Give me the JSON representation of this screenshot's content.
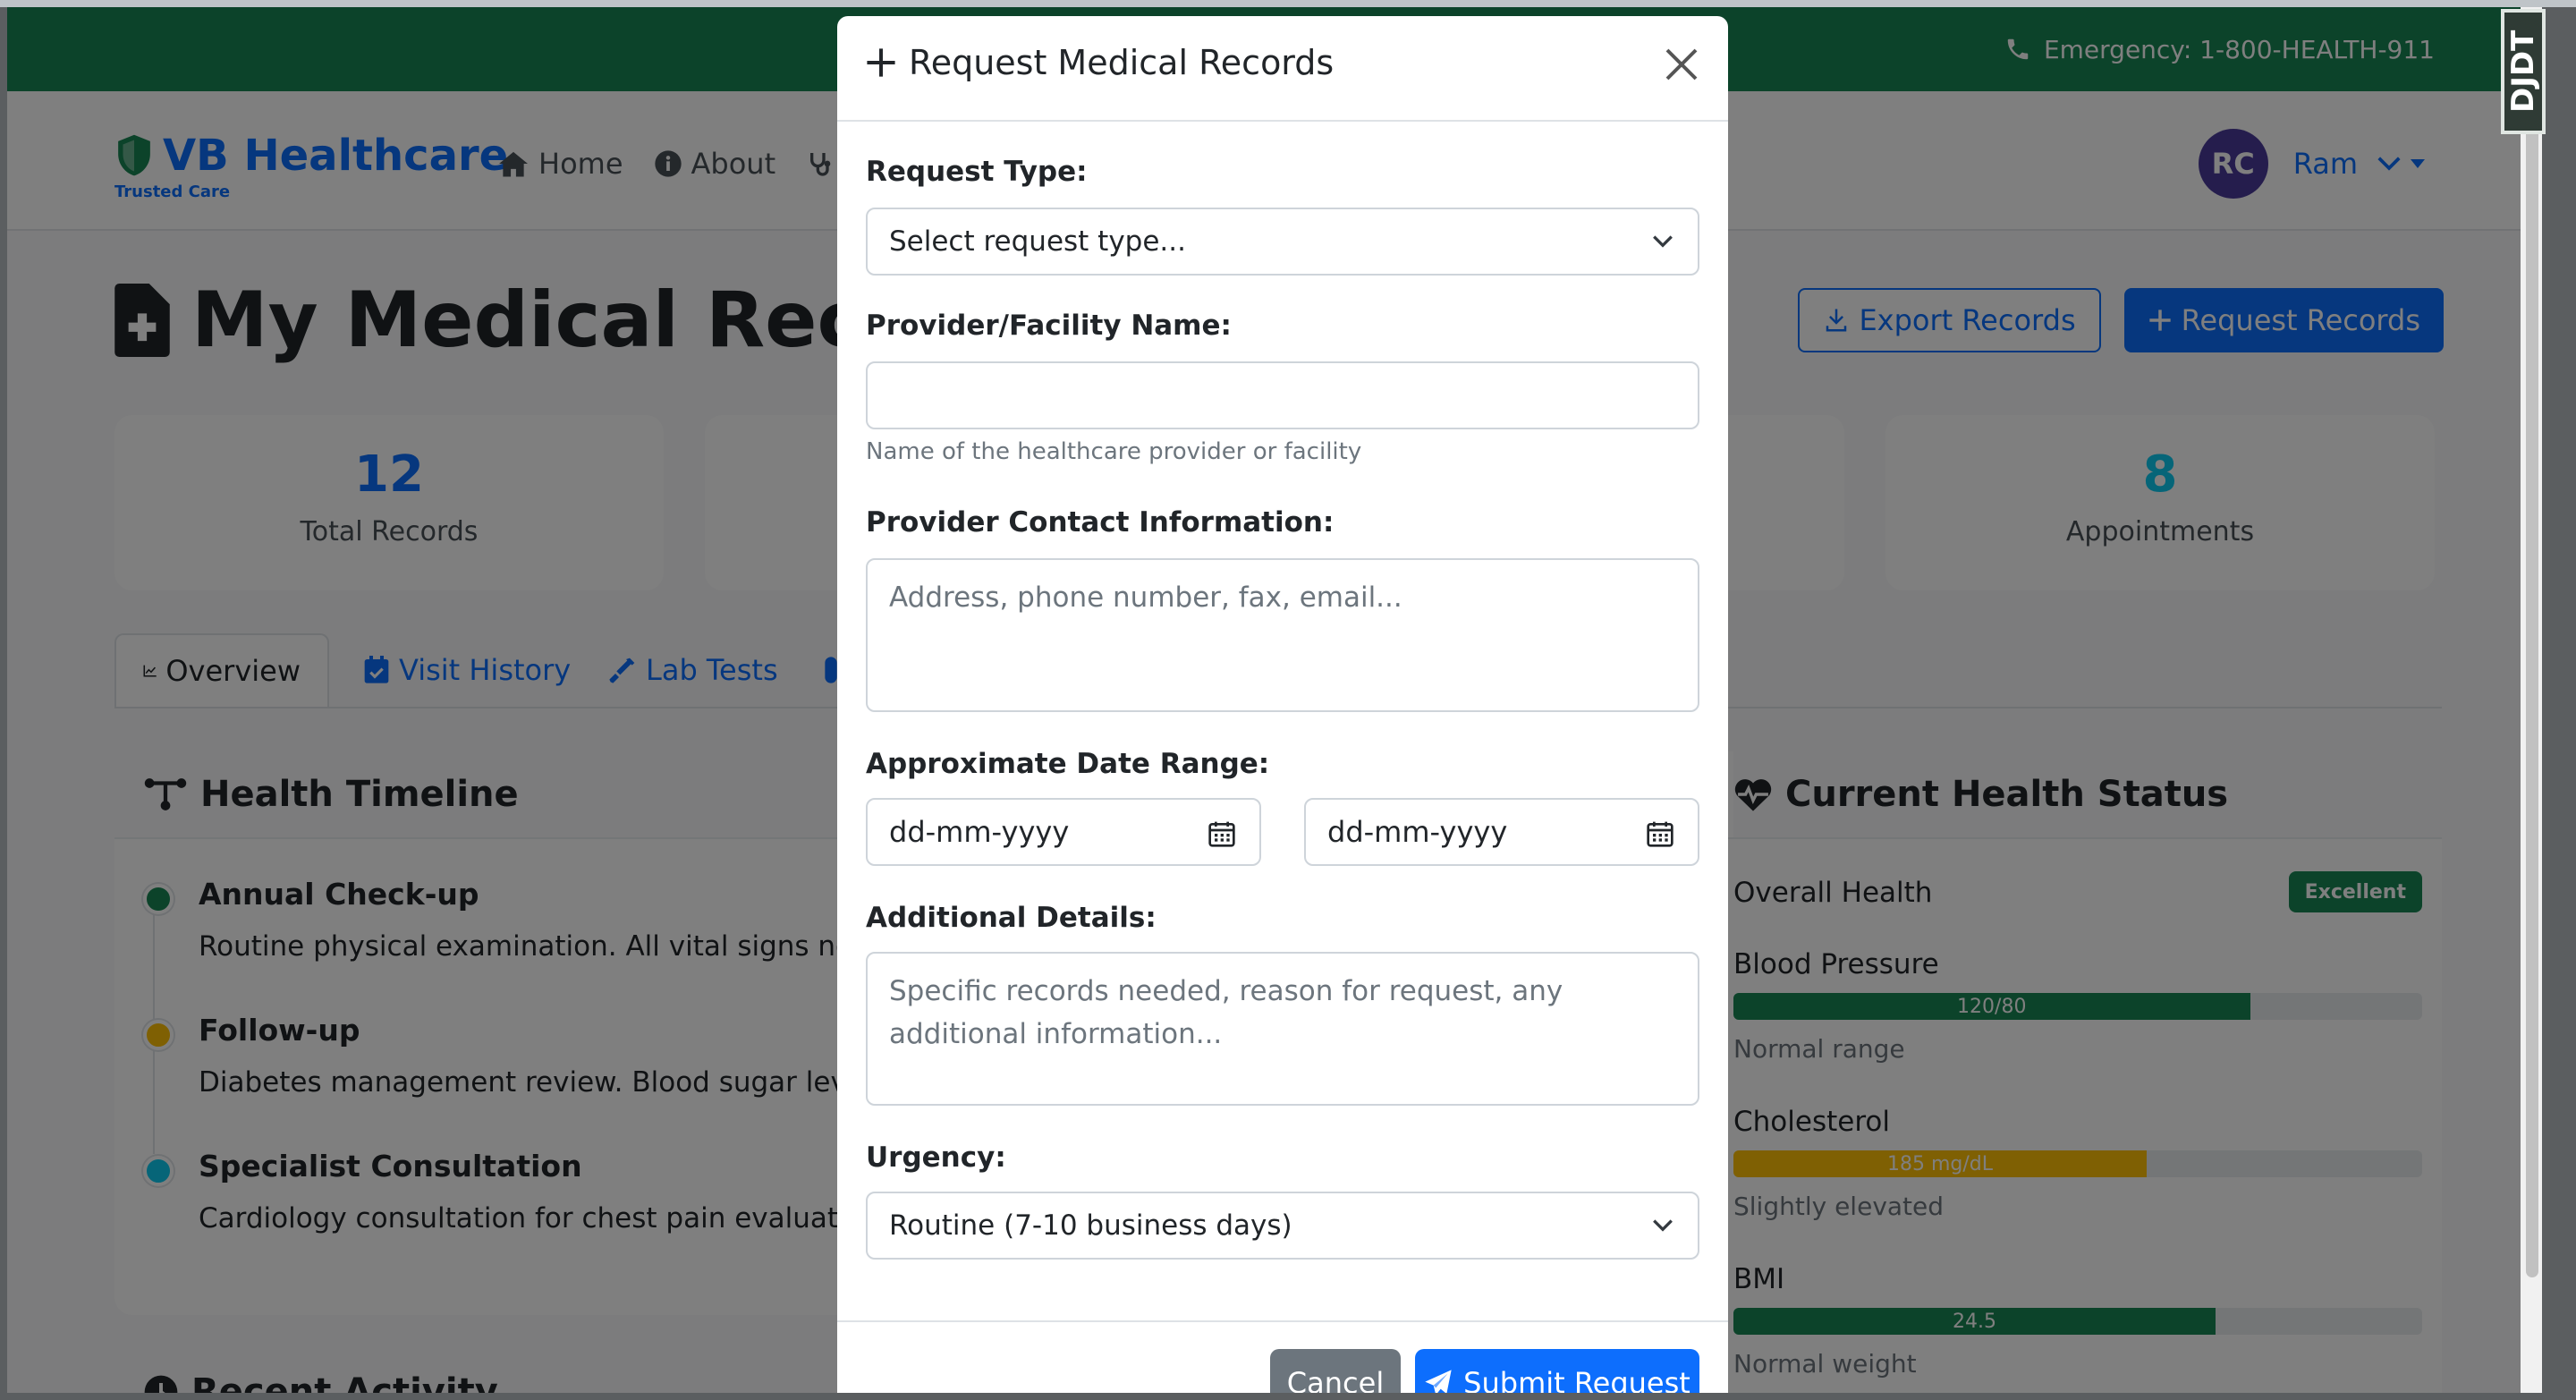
{
  "topbar": {
    "emergency": "Emergency: 1-800-HEALTH-911"
  },
  "brand": {
    "name": "VB Healthcare",
    "tagline": "Trusted Care"
  },
  "nav": {
    "home": "Home",
    "about": "About"
  },
  "user": {
    "initials": "RC",
    "name": "Ram"
  },
  "page": {
    "title": "My Medical Records",
    "export_label": "Export Records",
    "request_label": "Request Records"
  },
  "stats": [
    {
      "value": "12",
      "label": "Total Records",
      "color": "#0d6efd"
    },
    {
      "value": "8",
      "label": "Appointments",
      "color": "#0dcaf0"
    }
  ],
  "tabs": {
    "overview": "Overview",
    "visit_history": "Visit History",
    "lab_tests": "Lab Tests"
  },
  "timeline": {
    "title": "Health Timeline",
    "items": [
      {
        "title": "Annual Check-up",
        "desc": "Routine physical examination. All vital signs normal.",
        "color": "#198754"
      },
      {
        "title": "Follow-up",
        "desc": "Diabetes management review. Blood sugar levels stable.",
        "color": "#ffc107"
      },
      {
        "title": "Specialist Consultation",
        "desc": "Cardiology consultation for chest pain evaluation.",
        "color": "#0dcaf0"
      }
    ]
  },
  "recent": {
    "title": "Recent Activity"
  },
  "health_status": {
    "title": "Current Health Status",
    "overall_label": "Overall Health",
    "overall_badge": "Excellent",
    "metrics": [
      {
        "label": "Blood Pressure",
        "value": "120/80",
        "fill": 0.75,
        "color": "#198754",
        "note": "Normal range"
      },
      {
        "label": "Cholesterol",
        "value": "185 mg/dL",
        "fill": 0.6,
        "color": "#ffc107",
        "note": "Slightly elevated"
      },
      {
        "label": "BMI",
        "value": "24.5",
        "fill": 0.7,
        "color": "#198754",
        "note": "Normal weight"
      }
    ]
  },
  "modal": {
    "title": "Request Medical Records",
    "request_type_label": "Request Type:",
    "request_type_value": "Select request type...",
    "provider_label": "Provider/Facility Name:",
    "provider_value": "",
    "provider_hint": "Name of the healthcare provider or facility",
    "contact_label": "Provider Contact Information:",
    "contact_placeholder": "Address, phone number, fax, email...",
    "date_label": "Approximate Date Range:",
    "date_from": "dd-mm-yyyy",
    "date_to": "dd-mm-yyyy",
    "details_label": "Additional Details:",
    "details_placeholder": "Specific records needed, reason for request, any additional information...",
    "urgency_label": "Urgency:",
    "urgency_value": "Routine (7-10 business days)",
    "cancel_label": "Cancel",
    "submit_label": "Submit Request"
  },
  "extension": {
    "label": "DJDT"
  }
}
